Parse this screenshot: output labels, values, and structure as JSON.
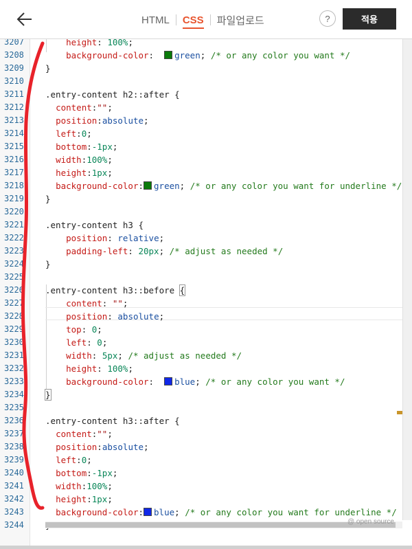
{
  "header": {
    "tabs": [
      {
        "label": "HTML",
        "active": false
      },
      {
        "label": "CSS",
        "active": true
      },
      {
        "label": "파일업로드",
        "active": false
      }
    ],
    "help_label": "?",
    "apply_label": "적용"
  },
  "editor": {
    "lines": [
      {
        "n": "3207",
        "html": "    <span class=\"prop\">height</span>: <span class=\"num\">100%</span>;"
      },
      {
        "n": "3208",
        "html": "    <span class=\"prop\">background-color</span>:  <span class=\"swatch\" style=\"background:#0a7a0a\"></span><span class=\"val\">green</span>; <span class=\"cmt\">/* or any color you want */</span>"
      },
      {
        "n": "3209",
        "html": "<span class=\"brace\">}</span>"
      },
      {
        "n": "3210",
        "html": ""
      },
      {
        "n": "3211",
        "html": "<span class=\"sel\">.entry-content h2::after {</span>"
      },
      {
        "n": "3212",
        "html": "  <span class=\"prop\">content</span>:<span class=\"str\">\"\"</span>;"
      },
      {
        "n": "3213",
        "html": "  <span class=\"prop\">position</span>:<span class=\"val\">absolute</span>;"
      },
      {
        "n": "3214",
        "html": "  <span class=\"prop\">left</span>:<span class=\"num\">0</span>;"
      },
      {
        "n": "3215",
        "html": "  <span class=\"prop\">bottom</span>:<span class=\"num\">-1px</span>;"
      },
      {
        "n": "3216",
        "html": "  <span class=\"prop\">width</span>:<span class=\"num\">100%</span>;"
      },
      {
        "n": "3217",
        "html": "  <span class=\"prop\">height</span>:<span class=\"num\">1px</span>;"
      },
      {
        "n": "3218",
        "html": "  <span class=\"prop\">background-color</span>:<span class=\"swatch\" style=\"background:#0a7a0a\"></span><span class=\"val\">green</span>; <span class=\"cmt\">/* or any color you want for underline */</span>"
      },
      {
        "n": "3219",
        "html": "<span class=\"brace\">}</span>"
      },
      {
        "n": "3220",
        "html": ""
      },
      {
        "n": "3221",
        "html": "<span class=\"sel\">.entry-content h3 {</span>"
      },
      {
        "n": "3222",
        "html": "    <span class=\"prop\">position</span>: <span class=\"val\">relative</span>;"
      },
      {
        "n": "3223",
        "html": "    <span class=\"prop\">padding-left</span>: <span class=\"num\">20px</span>; <span class=\"cmt\">/* adjust as needed */</span>"
      },
      {
        "n": "3224",
        "html": "<span class=\"brace\">}</span>"
      },
      {
        "n": "3225",
        "html": ""
      },
      {
        "n": "3226",
        "html": "<span class=\"sel\">.entry-content h3::before </span><span class=\"box\">{</span>"
      },
      {
        "n": "3227",
        "html": "    <span class=\"prop\">content</span>: <span class=\"str\">\"\"</span>;"
      },
      {
        "n": "3228",
        "html": "    <span class=\"prop\">position</span>: <span class=\"val\">absolute</span>;"
      },
      {
        "n": "3229",
        "html": "    <span class=\"prop\">top</span>: <span class=\"num\">0</span>;"
      },
      {
        "n": "3230",
        "html": "    <span class=\"prop\">left</span>: <span class=\"num\">0</span>;"
      },
      {
        "n": "3231",
        "html": "    <span class=\"prop\">width</span>: <span class=\"num\">5px</span>; <span class=\"cmt\">/* adjust as needed */</span>"
      },
      {
        "n": "3232",
        "html": "    <span class=\"prop\">height</span>: <span class=\"num\">100%</span>;"
      },
      {
        "n": "3233",
        "html": "    <span class=\"prop\">background-color</span>:  <span class=\"swatch\" style=\"background:#1028e8\"></span><span class=\"val\">blue</span>; <span class=\"cmt\">/* or any color you want */</span>"
      },
      {
        "n": "3234",
        "html": "<span class=\"box\">}</span>"
      },
      {
        "n": "3235",
        "html": ""
      },
      {
        "n": "3236",
        "html": "<span class=\"sel\">.entry-content h3::after {</span>"
      },
      {
        "n": "3237",
        "html": "  <span class=\"prop\">content</span>:<span class=\"str\">\"\"</span>;"
      },
      {
        "n": "3238",
        "html": "  <span class=\"prop\">position</span>:<span class=\"val\">absolute</span>;"
      },
      {
        "n": "3239",
        "html": "  <span class=\"prop\">left</span>:<span class=\"num\">0</span>;"
      },
      {
        "n": "3240",
        "html": "  <span class=\"prop\">bottom</span>:<span class=\"num\">-1px</span>;"
      },
      {
        "n": "3241",
        "html": "  <span class=\"prop\">width</span>:<span class=\"num\">100%</span>;"
      },
      {
        "n": "3242",
        "html": "  <span class=\"prop\">height</span>:<span class=\"num\">1px</span>;"
      },
      {
        "n": "3243",
        "html": "  <span class=\"prop\">background-color</span>:<span class=\"swatch\" style=\"background:#1028e8\"></span><span class=\"val\">blue</span>; <span class=\"cmt\">/* or any color you want for underline */</span>"
      },
      {
        "n": "3244",
        "html": "<span class=\"brace\">}</span>"
      }
    ],
    "footer_label": "@ open source"
  }
}
